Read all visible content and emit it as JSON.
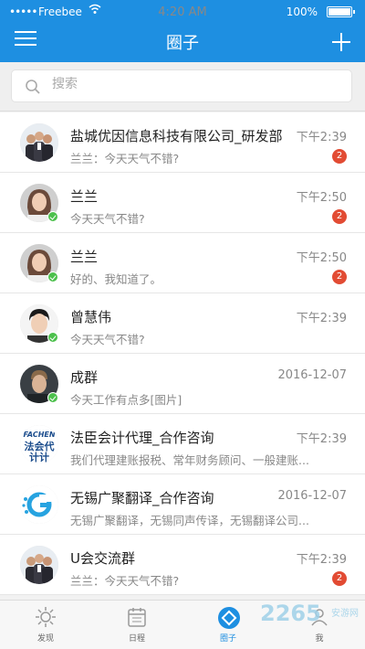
{
  "status_bar": {
    "carrier": "Freebee",
    "time": "4:20 AM",
    "battery": "100%"
  },
  "header": {
    "title": "圈子"
  },
  "search": {
    "placeholder": "搜索"
  },
  "conversations": [
    {
      "name": "盐城优因信息科技有限公司_研发部",
      "message": "兰兰：今天天气不错?",
      "time": "下午2:39",
      "badge": "2",
      "avatar": "group-avatar",
      "online": false
    },
    {
      "name": "兰兰",
      "message": "今天天气不错?",
      "time": "下午2:50",
      "badge": "2",
      "avatar": "woman-avatar",
      "online": true
    },
    {
      "name": "兰兰",
      "message": "好的、我知道了。",
      "time": "下午2:50",
      "badge": "2",
      "avatar": "woman-avatar",
      "online": true
    },
    {
      "name": "曾慧伟",
      "message": "今天天气不错?",
      "time": "下午2:39",
      "badge": "",
      "avatar": "man-avatar",
      "online": true
    },
    {
      "name": "成群",
      "message": "今天工作有点多[图片]",
      "time": "2016-12-07",
      "badge": "",
      "avatar": "man-dark-avatar",
      "online": true
    },
    {
      "name": "法臣会计代理_合作咨询",
      "message": "我们代理建账报税、常年财务顾问、一般建账...",
      "time": "下午2:39",
      "badge": "",
      "avatar": "logo-fachen",
      "online": false,
      "logo_text": "FACHEN",
      "logo_sub": "法会代\n计计"
    },
    {
      "name": "无锡广聚翻译_合作咨询",
      "message": "无锡广聚翻译，无锡同声传译，无锡翻译公司...",
      "time": "2016-12-07",
      "badge": "",
      "avatar": "logo-g",
      "online": false
    },
    {
      "name": "U会交流群",
      "message": "兰兰：今天天气不错?",
      "time": "下午2:39",
      "badge": "2",
      "avatar": "group-avatar",
      "online": false
    }
  ],
  "tabs": [
    {
      "label": "发现",
      "icon": "discover-icon",
      "active": false
    },
    {
      "label": "日程",
      "icon": "calendar-icon",
      "active": false
    },
    {
      "label": "圈子",
      "icon": "circle-icon",
      "active": true
    },
    {
      "label": "我",
      "icon": "me-icon",
      "active": false
    }
  ],
  "watermark": {
    "text": "2265",
    "sub": "安游网"
  },
  "colors": {
    "primary": "#1e8fe1",
    "badge": "#e24b33",
    "online": "#4cc04c"
  }
}
